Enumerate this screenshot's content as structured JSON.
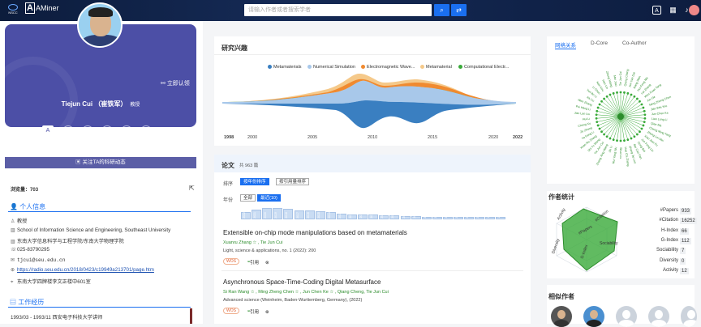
{
  "topbar": {
    "logo_org_text": "AMiner",
    "logo_sub": "NSCC",
    "search_placeholder": "请输入作者或者搜索学者",
    "search_icon": "search-icon",
    "translate_icon": "swap-icon",
    "icons": [
      "translate-icon",
      "apps-grid-icon",
      "notification-bell-icon",
      "user-avatar-icon"
    ]
  },
  "profile": {
    "name": "Tiejun Cui （崔铁军）",
    "title": "教授",
    "claim": "立即认领",
    "follow": "关注TA的科研动态",
    "views_label": "浏览量：",
    "views": "703",
    "social_icons": [
      "aminer-icon",
      "home-icon",
      "facebook-icon",
      "twitter-icon",
      "youtube-icon",
      "scholar-icon"
    ]
  },
  "personal": {
    "title": "个人信息",
    "rows": [
      {
        "icon": "user-icon",
        "text": "教授"
      },
      {
        "icon": "building-icon",
        "text": "School of Information Science and Engineering, Southeast University"
      },
      {
        "icon": "building-icon",
        "text": "东南大学信息科学与工程学院/东南大学物理学院"
      },
      {
        "icon": "phone-icon",
        "text": "025-83790295"
      },
      {
        "icon": "email-icon",
        "text": "tjcui@seu.edu.cn"
      },
      {
        "icon": "link-icon",
        "text": "https://radio.seu.edu.cn/2018/0423/c19949a213701/page.htm"
      },
      {
        "icon": "location-icon",
        "text": "东南大学四牌楼李文正楼中601室"
      }
    ]
  },
  "work": {
    "title": "工作经历",
    "rows": [
      "1993/03 - 1993/11 西安电子科技大学讲师"
    ]
  },
  "interest": {
    "title": "研究兴趣",
    "legend": [
      {
        "name": "Metamaterials",
        "color": "#3a7fc1"
      },
      {
        "name": "Numerical Simulation",
        "color": "#a8c8ea"
      },
      {
        "name": "Electromagnetic Wave...",
        "color": "#f08a30"
      },
      {
        "name": "Metamaterial",
        "color": "#f5c98a"
      },
      {
        "name": "Computational Electr...",
        "color": "#3aaa3a"
      }
    ],
    "years": [
      "1998",
      "2000",
      "2005",
      "2010",
      "2015",
      "2020",
      "2022"
    ]
  },
  "papers": {
    "title": "论文",
    "count": "共 963 篇",
    "sort_label": "排序",
    "sort_by_year": "按年份排序",
    "sort_by_cite": "按引用量排序",
    "year_label": "年份",
    "all": "全部",
    "recent": "最近(10)",
    "year_bars": [
      {
        "y": "2022",
        "v": 0.55
      },
      {
        "y": "2021",
        "v": 0.75
      },
      {
        "y": "2020",
        "v": 0.85
      },
      {
        "y": "2019",
        "v": 0.9
      },
      {
        "y": "2018",
        "v": 0.8
      },
      {
        "y": "2017",
        "v": 0.7
      },
      {
        "y": "2016",
        "v": 0.7
      },
      {
        "y": "2015",
        "v": 0.6
      },
      {
        "y": "2014",
        "v": 0.55
      },
      {
        "y": "2013",
        "v": 0.45
      },
      {
        "y": "2012",
        "v": 0.4
      },
      {
        "y": "2011",
        "v": 0.4
      },
      {
        "y": "2010",
        "v": 0.35
      },
      {
        "y": "2009",
        "v": 0.3
      },
      {
        "y": "2008",
        "v": 0.3
      },
      {
        "y": "2007",
        "v": 0.25
      },
      {
        "y": "2006",
        "v": 0.25
      },
      {
        "y": "2005",
        "v": 0.2
      },
      {
        "y": "2004",
        "v": 0.2
      },
      {
        "y": "2003",
        "v": 0.15
      },
      {
        "y": "2002",
        "v": 0.15
      },
      {
        "y": "2001",
        "v": 0.1
      },
      {
        "y": "2000",
        "v": 0.1
      },
      {
        "y": "1999",
        "v": 0.1
      },
      {
        "y": "1998",
        "v": 0.05
      }
    ],
    "items": [
      {
        "title": "Extensible on-chip mode manipulations based on metamaterials",
        "authors": "Xuanru Zhang ☆ , Tie Jun Cui",
        "venue": "Light, science & applications, no. 1 (2022): 200",
        "badge": "WOS",
        "cite": "引用"
      },
      {
        "title": "Asynchronous Space-Time-Coding Digital Metasurface",
        "authors": "Si Ran Wang ☆ , Ming Zheng Chen ☆ , Jun Chen Ke ☆ , Qiang Cheng, Tie Jun Cui",
        "venue": "Advanced science (Weinheim, Baden-Wurttemberg, Germany), (2022)",
        "badge": "WOS",
        "cite": "引用"
      }
    ]
  },
  "network": {
    "tabs": [
      "网络关系",
      "D-Core",
      "Co-Author"
    ],
    "names": [
      "Tie Jun Cui",
      "Qiang Cheng",
      "Jun Yan Dai",
      "Xiang Wan",
      "Hui Feng Ma",
      "Lei Zhang",
      "Wen Xuan Tang",
      "Xin Ge",
      "Ming Zheng Chen",
      "Jian Wei You",
      "Jun Chen Ke",
      "Lian Long Li",
      "Qian Ma",
      "Cheng Ming Tang",
      "Zhong Lei Mei",
      "Xiao Jian Fu",
      "Jun Feng Liu",
      "Dong Bai",
      "Bai Cao Pan",
      "Zhang Jie Luo",
      "Hao Chi Zhang",
      "Shuo Liu",
      "Rui Yang Wu",
      "Jie Li",
      "Zheng Xing Wang",
      "Tie Jun Cui",
      "Shi Yu Wang",
      "Xuan Ru Zhang",
      "Ya Feng Li",
      "Ze Zhang",
      "Cheng Xu",
      "Hui Li",
      "Jian Lan Liu",
      "Pei Hang Li",
      "Wen Zhang",
      "Jia Liu",
      "Yun Bo Li",
      "Li Chen",
      "Nan Kou",
      "Hao Lin",
      "Zheng Wang",
      "Mei Jiao"
    ]
  },
  "stats": {
    "title": "作者统计",
    "radar_labels": [
      "Activity",
      "#Citation",
      "Sociability",
      "Diversity",
      "#Papers",
      "G-Index"
    ],
    "rows": [
      {
        "label": "#Papers",
        "value": "933"
      },
      {
        "label": "#Citation",
        "value": "16252"
      },
      {
        "label": "H-Index",
        "value": "66"
      },
      {
        "label": "G-Index",
        "value": "112"
      },
      {
        "label": "Sociability",
        "value": "7"
      },
      {
        "label": "Diversity",
        "value": "0"
      },
      {
        "label": "Activity",
        "value": "12"
      }
    ]
  },
  "similar": {
    "title": "相似作者"
  }
}
